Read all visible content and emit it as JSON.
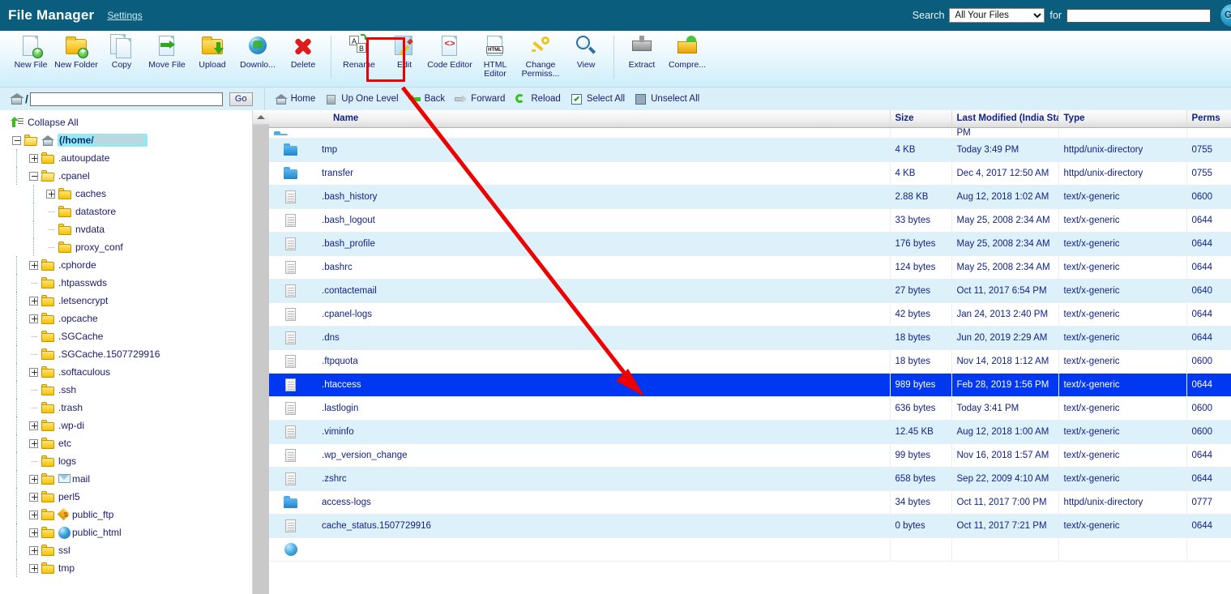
{
  "header": {
    "title": "File Manager",
    "settings_label": "Settings",
    "search_label": "Search",
    "for_label": "for",
    "search_scope_value": "All Your Files",
    "search_scope_options": [
      "All Your Files"
    ],
    "search_input_value": "",
    "go_label": "GO",
    "bg_color": "#0a5d7c"
  },
  "toolbar": {
    "items": [
      {
        "label": "New File",
        "icon": "new-file-icon"
      },
      {
        "label": "New Folder",
        "icon": "new-folder-icon"
      },
      {
        "label": "Copy",
        "icon": "copy-icon"
      },
      {
        "label": "Move File",
        "icon": "move-file-icon"
      },
      {
        "label": "Upload",
        "icon": "upload-icon"
      },
      {
        "label": "Downlo...",
        "icon": "download-icon"
      },
      {
        "label": "Delete",
        "icon": "delete-icon"
      },
      {
        "label": "Rename",
        "icon": "rename-icon"
      },
      {
        "label": "Edit",
        "icon": "edit-icon"
      },
      {
        "label": "Code Editor",
        "icon": "code-editor-icon"
      },
      {
        "label": "HTML Editor",
        "icon": "html-editor-icon"
      },
      {
        "label": "Change Permiss...",
        "icon": "change-permissions-icon"
      },
      {
        "label": "View",
        "icon": "view-icon"
      },
      {
        "label": "Extract",
        "icon": "extract-icon"
      },
      {
        "label": "Compre...",
        "icon": "compress-icon"
      }
    ],
    "highlight_color": "#ee0000",
    "highlighted_item": "Edit"
  },
  "pathbar": {
    "slash": "/",
    "input_value": "",
    "go_label": "Go",
    "nav": [
      {
        "label": "Home",
        "icon": "home-icon"
      },
      {
        "label": "Up One Level",
        "icon": "up-one-level-icon"
      },
      {
        "label": "Back",
        "icon": "back-arrow-icon"
      },
      {
        "label": "Forward",
        "icon": "forward-arrow-icon"
      },
      {
        "label": "Reload",
        "icon": "reload-icon"
      },
      {
        "label": "Select All",
        "icon": "checkbox-checked-icon"
      },
      {
        "label": "Unselect All",
        "icon": "checkbox-empty-icon"
      }
    ]
  },
  "sidebar": {
    "collapse_all_label": "Collapse All",
    "root_label": "(/home/",
    "tree": [
      {
        "label": ".autoupdate",
        "depth": 1,
        "toggle": "plus"
      },
      {
        "label": ".cpanel",
        "depth": 1,
        "toggle": "minus",
        "open": true
      },
      {
        "label": "caches",
        "depth": 2,
        "toggle": "plus"
      },
      {
        "label": "datastore",
        "depth": 2,
        "toggle": "none"
      },
      {
        "label": "nvdata",
        "depth": 2,
        "toggle": "none"
      },
      {
        "label": "proxy_conf",
        "depth": 2,
        "toggle": "none"
      },
      {
        "label": ".cphorde",
        "depth": 1,
        "toggle": "plus"
      },
      {
        "label": ".htpasswds",
        "depth": 1,
        "toggle": "none"
      },
      {
        "label": ".letsencrypt",
        "depth": 1,
        "toggle": "plus"
      },
      {
        "label": ".opcache",
        "depth": 1,
        "toggle": "plus"
      },
      {
        "label": ".SGCache",
        "depth": 1,
        "toggle": "none"
      },
      {
        "label": ".SGCache.1507729916",
        "depth": 1,
        "toggle": "none"
      },
      {
        "label": ".softaculous",
        "depth": 1,
        "toggle": "plus"
      },
      {
        "label": ".ssh",
        "depth": 1,
        "toggle": "none"
      },
      {
        "label": ".trash",
        "depth": 1,
        "toggle": "none"
      },
      {
        "label": ".wp-di",
        "depth": 1,
        "toggle": "plus"
      },
      {
        "label": "etc",
        "depth": 1,
        "toggle": "plus"
      },
      {
        "label": "logs",
        "depth": 1,
        "toggle": "none"
      },
      {
        "label": "mail",
        "depth": 1,
        "toggle": "plus",
        "extra_icon": "mail-icon"
      },
      {
        "label": "perl5",
        "depth": 1,
        "toggle": "plus"
      },
      {
        "label": "public_ftp",
        "depth": 1,
        "toggle": "plus",
        "extra_icon": "ftp-icon"
      },
      {
        "label": "public_html",
        "depth": 1,
        "toggle": "plus",
        "extra_icon": "globe-icon"
      },
      {
        "label": "ssl",
        "depth": 1,
        "toggle": "plus"
      },
      {
        "label": "tmp",
        "depth": 1,
        "toggle": "plus"
      }
    ]
  },
  "filetable": {
    "columns": [
      "Name",
      "Size",
      "Last Modified (India Star",
      "Type",
      "Perms"
    ],
    "rows": [
      {
        "name": "tmp",
        "size": "4 KB",
        "modified": "Today 3:49 PM",
        "type": "httpd/unix-directory",
        "perms": "0755",
        "icon": "folder-icon",
        "selected": false
      },
      {
        "name": "transfer",
        "size": "4 KB",
        "modified": "Dec 4, 2017 12:50 AM",
        "type": "httpd/unix-directory",
        "perms": "0755",
        "icon": "folder-icon",
        "selected": false
      },
      {
        "name": ".bash_history",
        "size": "2.88 KB",
        "modified": "Aug 12, 2018 1:02 AM",
        "type": "text/x-generic",
        "perms": "0600",
        "icon": "document-icon",
        "selected": false
      },
      {
        "name": ".bash_logout",
        "size": "33 bytes",
        "modified": "May 25, 2008 2:34 AM",
        "type": "text/x-generic",
        "perms": "0644",
        "icon": "document-icon",
        "selected": false
      },
      {
        "name": ".bash_profile",
        "size": "176 bytes",
        "modified": "May 25, 2008 2:34 AM",
        "type": "text/x-generic",
        "perms": "0644",
        "icon": "document-icon",
        "selected": false
      },
      {
        "name": ".bashrc",
        "size": "124 bytes",
        "modified": "May 25, 2008 2:34 AM",
        "type": "text/x-generic",
        "perms": "0644",
        "icon": "document-icon",
        "selected": false
      },
      {
        "name": ".contactemail",
        "size": "27 bytes",
        "modified": "Oct 11, 2017 6:54 PM",
        "type": "text/x-generic",
        "perms": "0640",
        "icon": "document-icon",
        "selected": false
      },
      {
        "name": ".cpanel-logs",
        "size": "42 bytes",
        "modified": "Jan 24, 2013 2:40 PM",
        "type": "text/x-generic",
        "perms": "0644",
        "icon": "document-icon",
        "selected": false
      },
      {
        "name": ".dns",
        "size": "18 bytes",
        "modified": "Jun 20, 2019 2:29 AM",
        "type": "text/x-generic",
        "perms": "0644",
        "icon": "document-icon",
        "selected": false
      },
      {
        "name": ".ftpquota",
        "size": "18 bytes",
        "modified": "Nov 14, 2018 1:12 AM",
        "type": "text/x-generic",
        "perms": "0600",
        "icon": "document-icon",
        "selected": false
      },
      {
        "name": ".htaccess",
        "size": "989 bytes",
        "modified": "Feb 28, 2019 1:56 PM",
        "type": "text/x-generic",
        "perms": "0644",
        "icon": "document-icon",
        "selected": true
      },
      {
        "name": ".lastlogin",
        "size": "636 bytes",
        "modified": "Today 3:41 PM",
        "type": "text/x-generic",
        "perms": "0600",
        "icon": "document-icon",
        "selected": false
      },
      {
        "name": ".viminfo",
        "size": "12.45 KB",
        "modified": "Aug 12, 2018 1:00 AM",
        "type": "text/x-generic",
        "perms": "0600",
        "icon": "document-icon",
        "selected": false
      },
      {
        "name": ".wp_version_change",
        "size": "99 bytes",
        "modified": "Nov 16, 2018 1:57 AM",
        "type": "text/x-generic",
        "perms": "0644",
        "icon": "document-icon",
        "selected": false
      },
      {
        "name": ".zshrc",
        "size": "658 bytes",
        "modified": "Sep 22, 2009 4:10 AM",
        "type": "text/x-generic",
        "perms": "0644",
        "icon": "document-icon",
        "selected": false
      },
      {
        "name": "access-logs",
        "size": "34 bytes",
        "modified": "Oct 11, 2017 7:00 PM",
        "type": "httpd/unix-directory",
        "perms": "0777",
        "icon": "folder-icon",
        "selected": false
      },
      {
        "name": "cache_status.1507729916",
        "size": "0 bytes",
        "modified": "Oct 11, 2017 7:21 PM",
        "type": "text/x-generic",
        "perms": "0644",
        "icon": "document-icon",
        "selected": false
      }
    ],
    "selected_row_color": "#0037f0",
    "alt_row_color": "#ddf1fb"
  },
  "annotation": {
    "type": "red-arrow",
    "color": "#ee0000",
    "from": "Edit toolbar button",
    "to": "file list area"
  }
}
